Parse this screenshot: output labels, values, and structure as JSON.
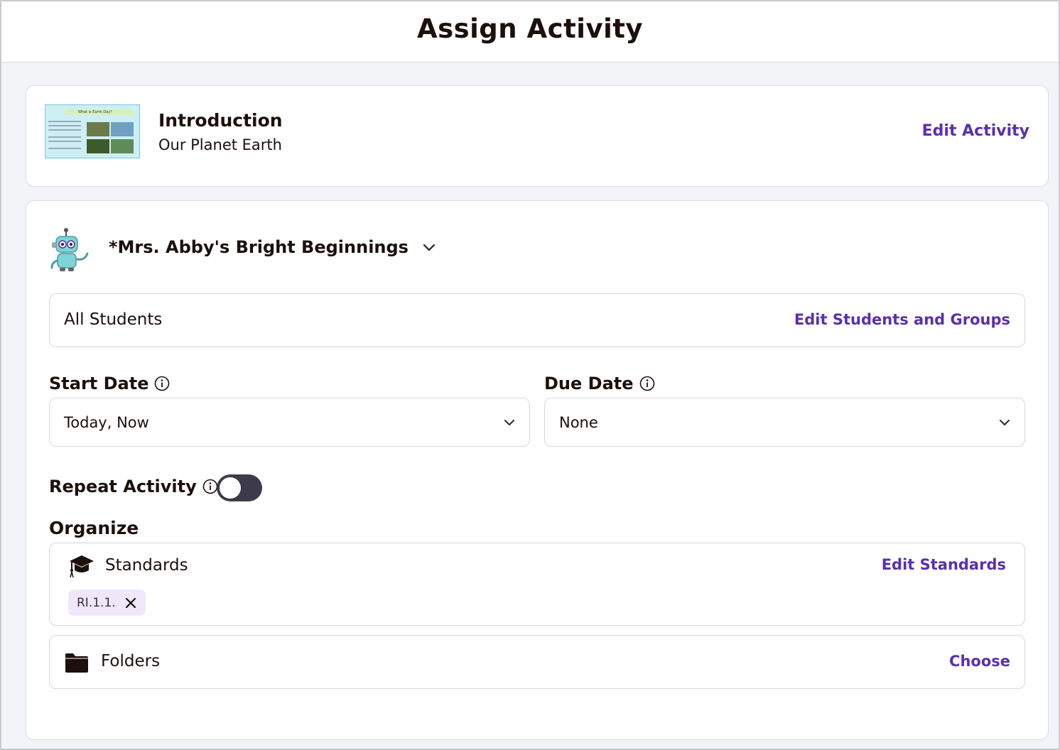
{
  "header": {
    "title": "Assign Activity"
  },
  "activity": {
    "title": "Introduction",
    "subtitle": "Our Planet Earth",
    "thumbnail_title": "What is Earth Day?",
    "edit_label": "Edit Activity"
  },
  "class": {
    "name": "*Mrs. Abby's Bright Beginnings",
    "avatar_icon": "robot-avatar-icon"
  },
  "students": {
    "label": "All Students",
    "edit_label": "Edit Students and Groups"
  },
  "start_date": {
    "label": "Start Date",
    "value": "Today, Now"
  },
  "due_date": {
    "label": "Due Date",
    "value": "None"
  },
  "repeat": {
    "label": "Repeat Activity",
    "enabled": false
  },
  "organize": {
    "label": "Organize",
    "standards": {
      "label": "Standards",
      "edit_label": "Edit Standards",
      "chips": [
        "RI.1.1."
      ]
    },
    "folders": {
      "label": "Folders",
      "choose_label": "Choose"
    }
  },
  "colors": {
    "accent": "#5a2fb0",
    "text": "#1c0f0c",
    "chip_bg": "#efe8fb",
    "toggle_off": "#3d3a4a",
    "background": "#f3f4f8"
  }
}
